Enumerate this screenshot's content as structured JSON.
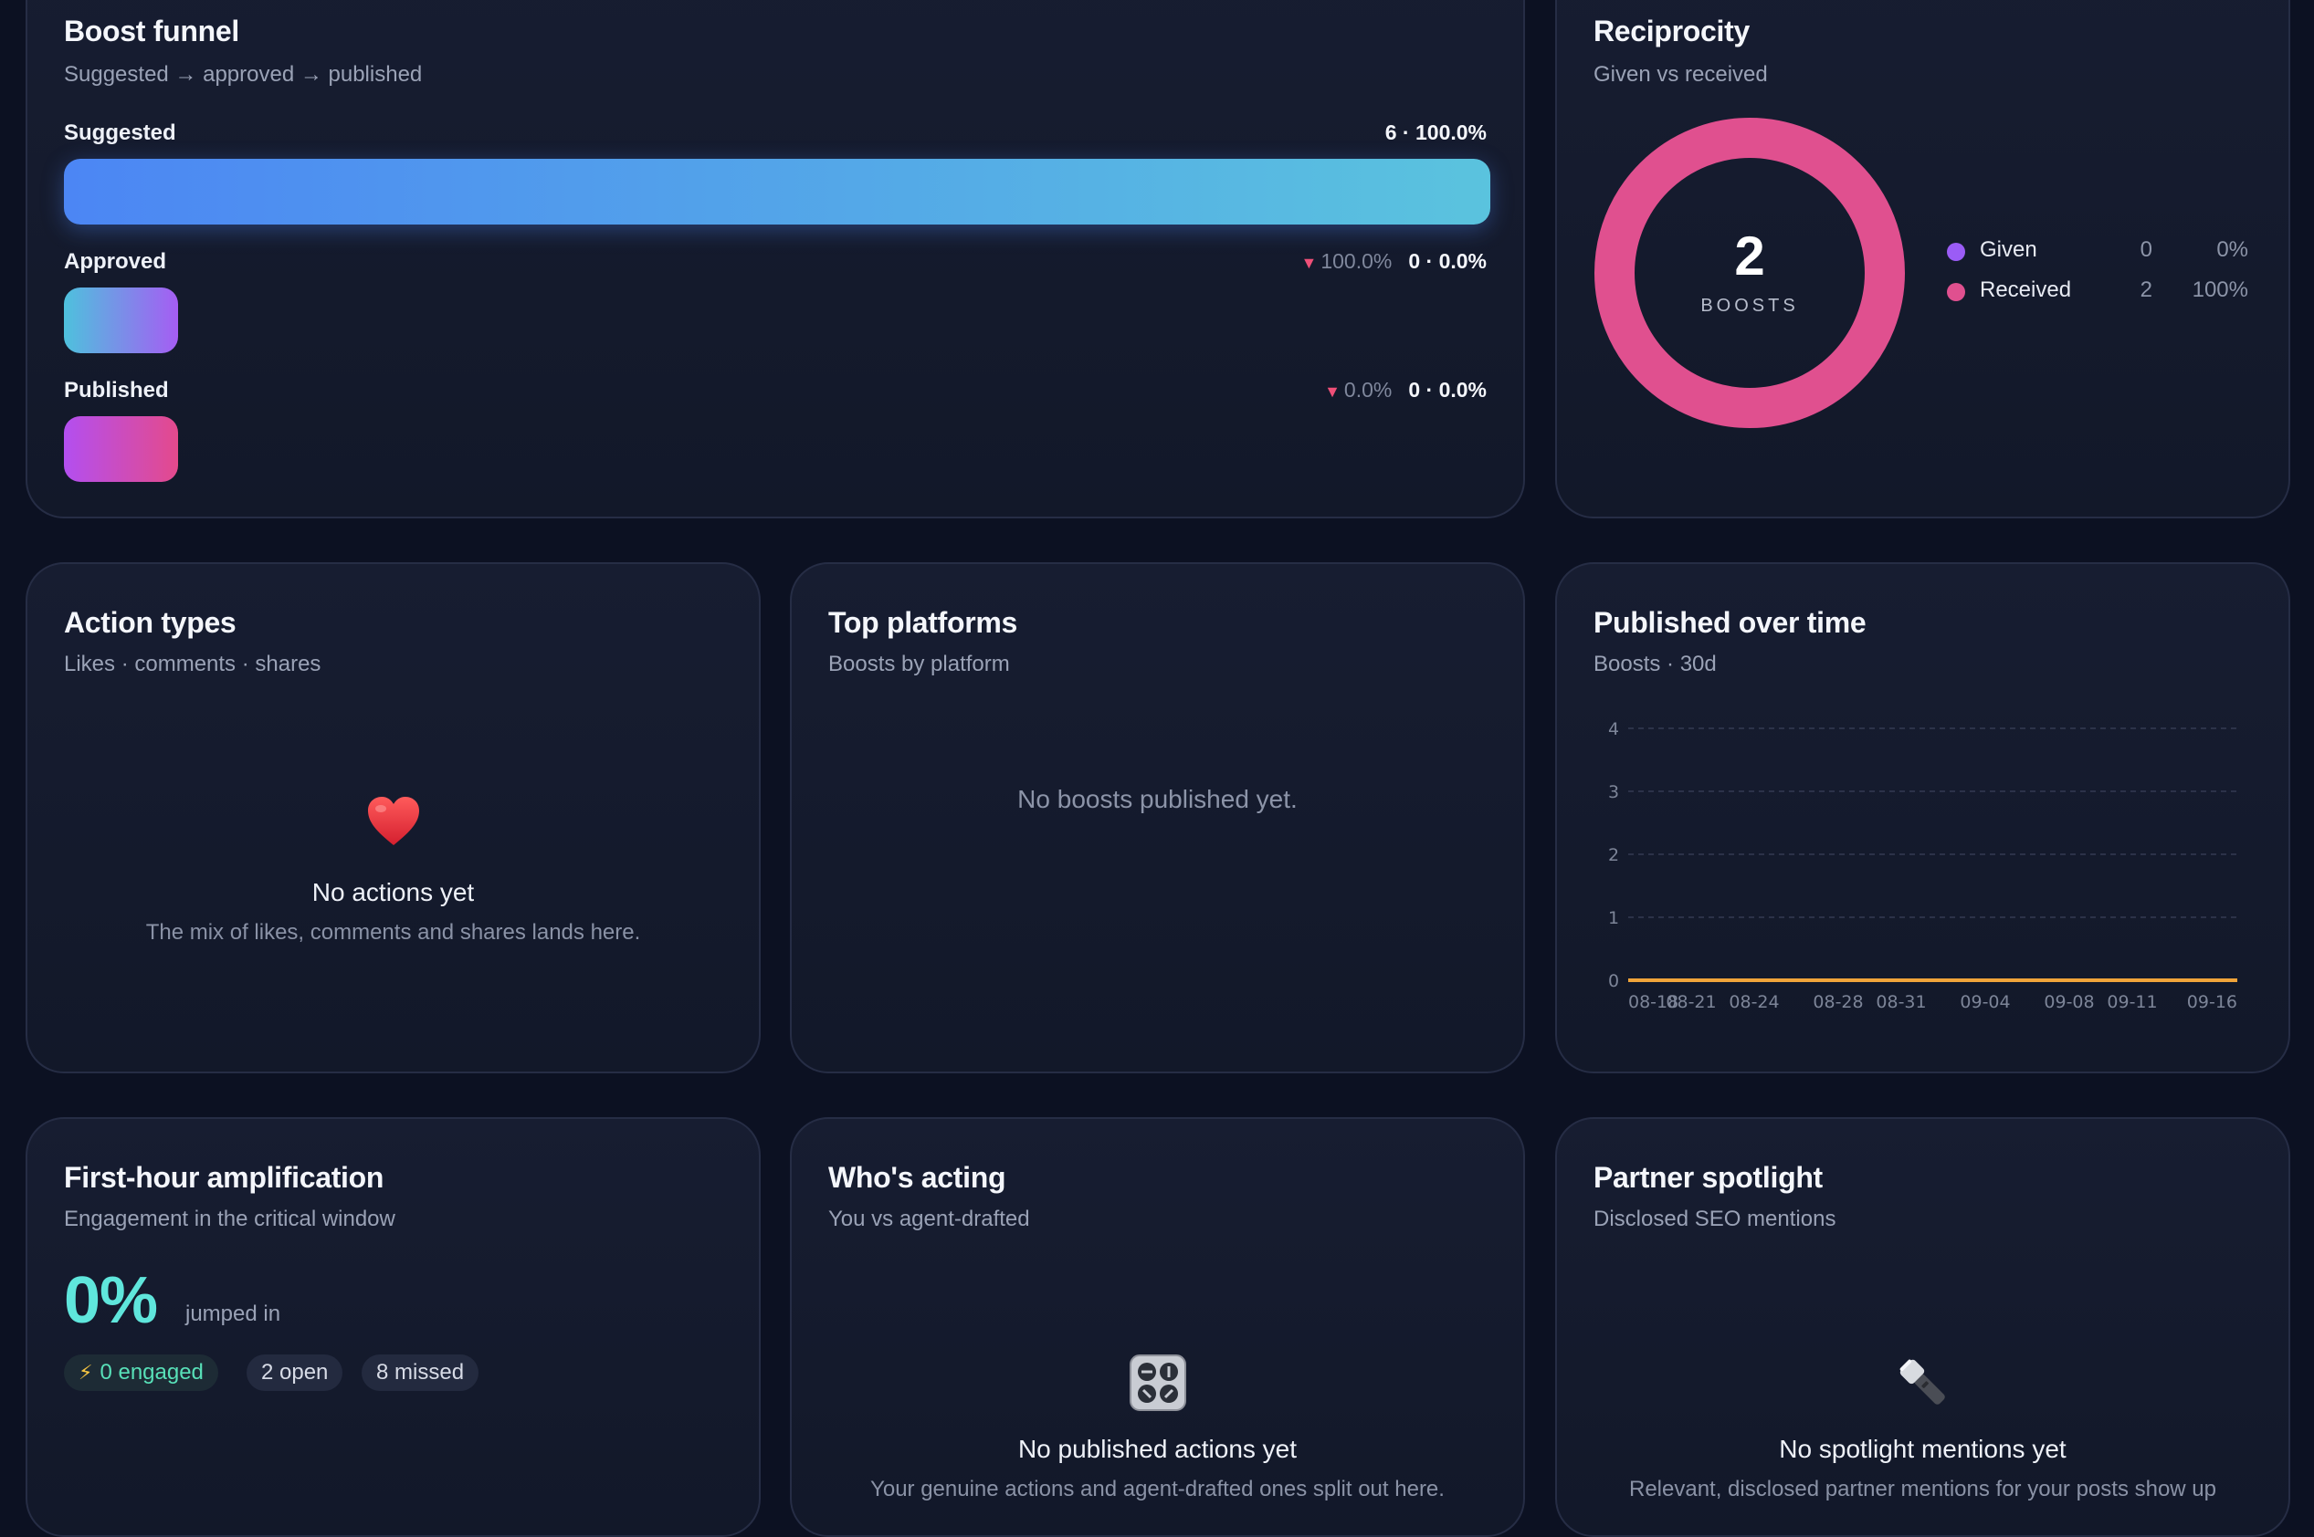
{
  "funnel": {
    "title": "Boost funnel",
    "subtitle": "Suggested → approved → published",
    "stages": [
      {
        "label": "Suggested",
        "count": "6 · 100.0%",
        "drop": "",
        "fraction": 1.0
      },
      {
        "label": "Approved",
        "count": "0 · 0.0%",
        "drop": "100.0%",
        "fraction": 0.0
      },
      {
        "label": "Published",
        "count": "0 · 0.0%",
        "drop": "0.0%",
        "fraction": 0.0
      }
    ]
  },
  "reciprocity": {
    "title": "Reciprocity",
    "subtitle": "Given vs received",
    "total": "2",
    "total_label": "BOOSTS",
    "items": [
      {
        "name": "Given",
        "value": "0",
        "pct": "0%",
        "color": "#9b5cf6"
      },
      {
        "name": "Received",
        "value": "2",
        "pct": "100%",
        "color": "#e0508f"
      }
    ]
  },
  "action_types": {
    "title": "Action types",
    "subtitle": "Likes · comments · shares",
    "empty_icon": "heart-icon",
    "empty_title": "No actions yet",
    "empty_text": "The mix of likes, comments and shares lands here."
  },
  "top_platforms": {
    "title": "Top platforms",
    "subtitle": "Boosts by platform",
    "empty_text": "No boosts published yet."
  },
  "published_over_time": {
    "title": "Published over time",
    "subtitle": "Boosts · 30d"
  },
  "first_hour": {
    "title": "First-hour amplification",
    "subtitle": "Engagement in the critical window",
    "big_value": "0%",
    "big_caption": "jumped in",
    "pills": {
      "engaged": "0 engaged",
      "open": "2 open",
      "missed": "8 missed"
    }
  },
  "whos_acting": {
    "title": "Who's acting",
    "subtitle": "You vs agent-drafted",
    "empty_icon": "control-knobs-icon",
    "empty_title": "No published actions yet",
    "empty_text": "Your genuine actions and agent-drafted ones split out here."
  },
  "partner_spotlight": {
    "title": "Partner spotlight",
    "subtitle": "Disclosed SEO mentions",
    "empty_icon": "flashlight-icon",
    "empty_title": "No spotlight mentions yet",
    "empty_text": "Relevant, disclosed partner mentions for your posts show up"
  },
  "colors": {
    "funnel_suggested": [
      "#4c86f4",
      "#5ac3de"
    ],
    "funnel_approved": [
      "#4ec1dd",
      "#a55df3"
    ],
    "funnel_published": [
      "#b34ff0",
      "#e44a8c"
    ],
    "received": "#e0508f",
    "line": "#f0a43a",
    "accent_teal": "#5fe6dc"
  },
  "chart_data": {
    "type": "line",
    "x": [
      "08-18",
      "08-21",
      "08-24",
      "08-28",
      "08-31",
      "09-04",
      "09-08",
      "09-11",
      "09-16"
    ],
    "series": [
      {
        "values": [
          0,
          0,
          0,
          0,
          0,
          0,
          0,
          0,
          0
        ]
      }
    ],
    "ylim": [
      0,
      4
    ],
    "yticks": [
      "0",
      "1",
      "2",
      "3",
      "4"
    ],
    "grid": true
  }
}
